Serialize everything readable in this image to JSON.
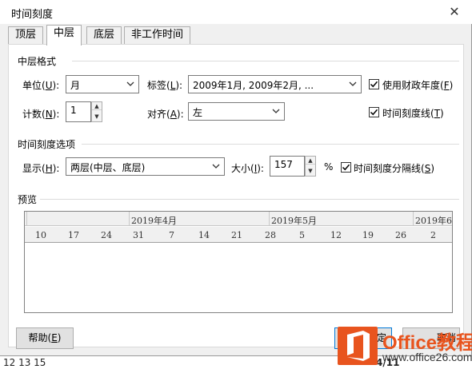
{
  "window": {
    "title": "时间刻度",
    "close_glyph": "✕"
  },
  "tabs": [
    {
      "label": "顶层",
      "active": false
    },
    {
      "label": "中层",
      "active": true
    },
    {
      "label": "底层",
      "active": false
    },
    {
      "label": "非工作时间",
      "active": false
    }
  ],
  "middle_format": {
    "group_label": "中层格式",
    "unit": {
      "label": "单位(",
      "key": "U",
      "suffix": "):",
      "value": "月"
    },
    "label_field": {
      "label": "标签(",
      "key": "L",
      "suffix": "):",
      "value": "2009年1月, 2009年2月, ..."
    },
    "fiscal_year": {
      "label": "使用财政年度(",
      "key": "F",
      "suffix": ")",
      "checked": true
    },
    "count": {
      "label": "计数(",
      "key": "N",
      "suffix": "):",
      "value": "1"
    },
    "align": {
      "label": "对齐(",
      "key": "A",
      "suffix": "):",
      "value": "左"
    },
    "tick_lines": {
      "label": "时间刻度线(",
      "key": "T",
      "suffix": ")",
      "checked": true
    }
  },
  "timescale_options": {
    "group_label": "时间刻度选项",
    "show": {
      "label": "显示(",
      "key": "H",
      "suffix": "):",
      "value": "两层(中层、底层)"
    },
    "size": {
      "label": "大小(",
      "key": "I",
      "suffix": "):",
      "value": "157",
      "unit": "%"
    },
    "separator": {
      "label": "时间刻度分隔线(",
      "key": "S",
      "suffix": ")",
      "checked": true
    }
  },
  "preview": {
    "group_label": "预览",
    "top_tier": [
      "2019年4月",
      "2019年5月",
      "2019年6"
    ],
    "bottom_tier": [
      "10",
      "17",
      "24",
      "31",
      "7",
      "14",
      "21",
      "28",
      "5",
      "12",
      "19",
      "26",
      "2"
    ]
  },
  "buttons": {
    "help": {
      "label": "帮助(",
      "key": "E",
      "suffix": ")"
    },
    "ok_partial": "定",
    "cancel_partial": "取消"
  },
  "background_app": {
    "row_text": "12 13 15",
    "date_text": "4/11"
  },
  "watermark": {
    "line1": "Office教程网",
    "line2": "www.office26.com"
  },
  "colors": {
    "accent": "#0078d7",
    "watermark_orange": "#e8541e"
  }
}
